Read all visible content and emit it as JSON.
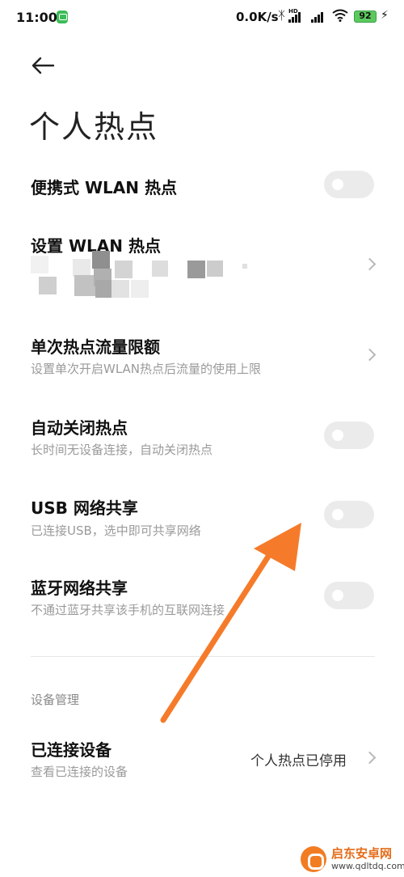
{
  "status_bar": {
    "time": "11:00",
    "net_speed": "0.0K/s",
    "hd_label": "HD",
    "battery": "92",
    "bluetooth_icon": "bluetooth-icon",
    "signal_icon": "signal-icon",
    "wifi_icon": "wifi-icon",
    "charging_icon": "charging-icon"
  },
  "header": {
    "back_icon": "arrow-left-icon",
    "title": "个人热点"
  },
  "rows": [
    {
      "title": "便携式 WLAN 热点",
      "control": "toggle",
      "enabled": false
    },
    {
      "title": "设置 WLAN 热点",
      "control": "chevron",
      "value": "pixelated / redacted"
    },
    {
      "title": "单次热点流量限额",
      "subtitle": "设置单次开启WLAN热点后流量的使用上限",
      "control": "chevron"
    },
    {
      "title": "自动关闭热点",
      "subtitle": "长时间无设备连接，自动关闭热点",
      "control": "toggle",
      "enabled": false
    },
    {
      "title": "USB 网络共享",
      "subtitle": "已连接USB，选中即可共享网络",
      "control": "toggle",
      "enabled": false
    },
    {
      "title": "蓝牙网络共享",
      "subtitle": "不通过蓝牙共享该手机的互联网连接",
      "control": "toggle",
      "enabled": false
    }
  ],
  "device_section": {
    "header": "设备管理",
    "title": "已连接设备",
    "subtitle": "查看已连接的设备",
    "value": "个人热点已停用"
  },
  "annotation": {
    "arrow_color": "#f57b2a"
  },
  "watermark": {
    "title": "启东安卓网",
    "url": "www.qdltdq.com"
  },
  "colors": {
    "toggle_off": "#ebebeb",
    "subtitle": "#9a9a9a",
    "battery": "#5bc95e"
  }
}
